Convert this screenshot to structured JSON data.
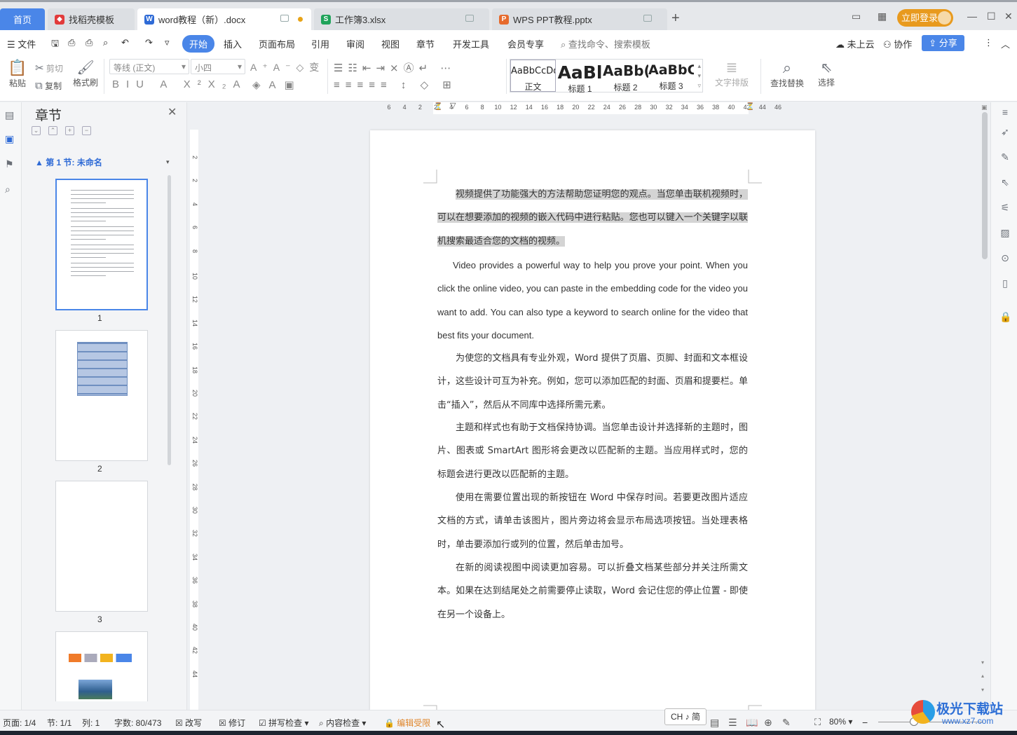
{
  "tabs": [
    {
      "label": "首页",
      "icon": "home"
    },
    {
      "label": "找稻壳模板",
      "icon": "docer-icon"
    },
    {
      "label": "word教程（新）.docx",
      "icon": "word-icon"
    },
    {
      "label": "工作簿3.xlsx",
      "icon": "sheet-icon"
    },
    {
      "label": "WPS PPT教程.pptx",
      "icon": "ppt-icon"
    }
  ],
  "tab_icons": {
    "word": "W",
    "sheet": "S",
    "ppt": "P"
  },
  "login_label": "立即登录",
  "menu": {
    "file": "文件",
    "items": [
      "开始",
      "插入",
      "页面布局",
      "引用",
      "审阅",
      "视图",
      "章节",
      "开发工具",
      "会员专享"
    ],
    "search": "查找命令、搜索模板",
    "cloud": "未上云",
    "collab": "协作",
    "share": "分享"
  },
  "ribbon": {
    "paste": "粘贴",
    "cut": "剪切",
    "copy": "复制",
    "format_painter": "格式刷",
    "font": "等线 (正文)",
    "size": "小四",
    "styles": [
      {
        "preview": "AaBbCcDd",
        "name": "正文"
      },
      {
        "preview": "AaBl",
        "name": "标题 1"
      },
      {
        "preview": "AaBb(",
        "name": "标题 2"
      },
      {
        "preview": "AaBbC",
        "name": "标题 3"
      }
    ],
    "text_layout": "文字排版",
    "find_replace": "查找替换",
    "select": "选择"
  },
  "nav": {
    "title": "章节",
    "section": "第 1 节: 未命名",
    "pages": [
      "1",
      "2",
      "3"
    ]
  },
  "ruler": {
    "h_ticks": [
      "6",
      "4",
      "2",
      "2",
      "4",
      "6",
      "8",
      "10",
      "12",
      "14",
      "16",
      "18",
      "20",
      "22",
      "24",
      "26",
      "28",
      "30",
      "32",
      "34",
      "36",
      "38",
      "40",
      "42",
      "44",
      "46"
    ],
    "v_ticks": [
      "2",
      "2",
      "4",
      "6",
      "8",
      "10",
      "12",
      "14",
      "16",
      "18",
      "20",
      "22",
      "24",
      "26",
      "28",
      "30",
      "32",
      "34",
      "36",
      "38",
      "40",
      "42",
      "44"
    ]
  },
  "document": {
    "p1_highlight": "视频提供了功能强大的方法帮助您证明您的观点。当您单击联机视频时，可以在想要添加的视频的嵌入代码中进行粘贴。您也可以键入一个关键字以联机搜索最适合您的文档的视频。",
    "p2": "Video provides a powerful way to help you prove your point. When you click the online video, you can paste in the embedding code for the video you want to add. You can also type a keyword to search online for the video that best fits your document.",
    "p3": "为使您的文档具有专业外观，Word 提供了页眉、页脚、封面和文本框设计，这些设计可互为补充。例如，您可以添加匹配的封面、页眉和提要栏。单击“插入”，然后从不同库中选择所需元素。",
    "p4": "主题和样式也有助于文档保持协调。当您单击设计并选择新的主题时，图片、图表或 SmartArt 图形将会更改以匹配新的主题。当应用样式时，您的标题会进行更改以匹配新的主题。",
    "p5": "使用在需要位置出现的新按钮在 Word 中保存时间。若要更改图片适应文档的方式，请单击该图片，图片旁边将会显示布局选项按钮。当处理表格时，单击要添加行或列的位置，然后单击加号。",
    "p6": "在新的阅读视图中阅读更加容易。可以折叠文档某些部分并关注所需文本。如果在达到结尾处之前需要停止读取，Word 会记住您的停止位置 - 即使在另一个设备上。"
  },
  "status": {
    "page": "页面: 1/4",
    "section": "节: 1/1",
    "column": "列: 1",
    "words": "字数: 80/473",
    "overwrite": "改写",
    "revise": "修订",
    "spell": "拼写检查",
    "content_check": "内容检查",
    "restrict": "编辑受限",
    "ime": "CH ♪ 简",
    "zoom": "80%"
  },
  "watermark": {
    "title": "极光下载站",
    "url": "www.xz7.com"
  },
  "colors": {
    "accent": "#4a86e8",
    "login": "#e89a1e",
    "warn": "#e0862b",
    "highlight": "#d4d4d4"
  }
}
